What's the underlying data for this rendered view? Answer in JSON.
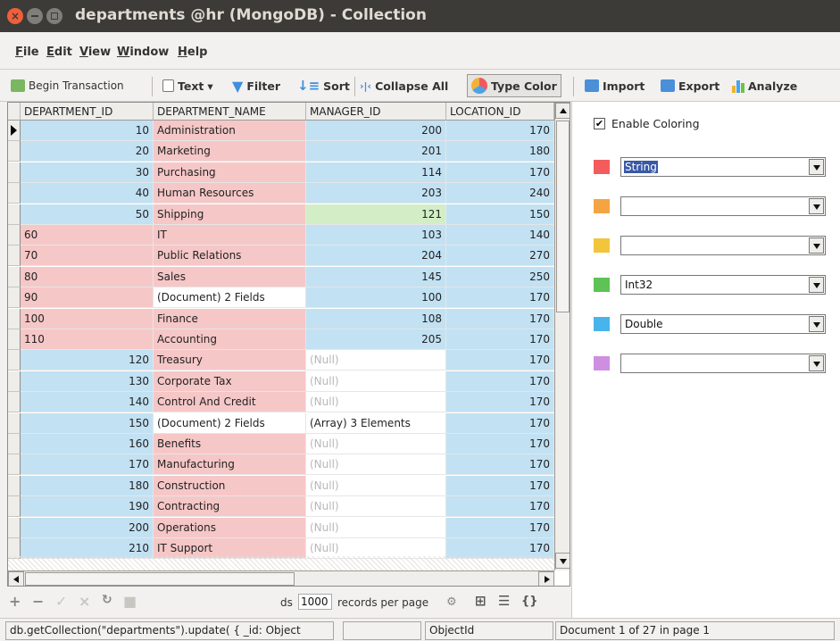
{
  "window": {
    "title": "departments @hr (MongoDB) - Collection"
  },
  "menu": [
    {
      "label": "File",
      "key": "F",
      "rest": "ile"
    },
    {
      "label": "Edit",
      "key": "E",
      "rest": "dit"
    },
    {
      "label": "View",
      "key": "V",
      "rest": "iew"
    },
    {
      "label": "Window",
      "key": "W",
      "rest": "indow"
    },
    {
      "label": "Help",
      "key": "H",
      "rest": "elp"
    }
  ],
  "toolbar": {
    "begin_transaction": "Begin Transaction",
    "text": "Text",
    "filter": "Filter",
    "sort": "Sort",
    "collapse_all": "Collapse All",
    "type_color": "Type Color",
    "import": "Import",
    "export": "Export",
    "analyze": "Analyze"
  },
  "grid": {
    "columns": [
      "DEPARTMENT_ID",
      "DEPARTMENT_NAME",
      "MANAGER_ID",
      "LOCATION_ID"
    ],
    "rows": [
      {
        "id": "10",
        "name": "Administration",
        "manager": "200",
        "location": "170",
        "id_color": "blue",
        "name_color": "red",
        "manager_color": "blue",
        "id_align": "right",
        "name_align": "left"
      },
      {
        "id": "20",
        "name": "Marketing",
        "manager": "201",
        "location": "180",
        "id_color": "blue",
        "name_color": "red",
        "manager_color": "blue",
        "id_align": "right",
        "name_align": "left"
      },
      {
        "id": "30",
        "name": "Purchasing",
        "manager": "114",
        "location": "170",
        "id_color": "blue",
        "name_color": "red",
        "manager_color": "blue",
        "id_align": "right",
        "name_align": "left"
      },
      {
        "id": "40",
        "name": "Human Resources",
        "manager": "203",
        "location": "240",
        "id_color": "blue",
        "name_color": "red",
        "manager_color": "blue",
        "id_align": "right",
        "name_align": "left"
      },
      {
        "id": "50",
        "name": "Shipping",
        "manager": "121",
        "location": "150",
        "id_color": "blue",
        "name_color": "red",
        "manager_color": "green",
        "id_align": "right",
        "name_align": "left"
      },
      {
        "id": "60",
        "name": "IT",
        "manager": "103",
        "location": "140",
        "id_color": "red",
        "name_color": "red",
        "manager_color": "blue",
        "id_align": "left",
        "name_align": "left"
      },
      {
        "id": "70",
        "name": "Public Relations",
        "manager": "204",
        "location": "270",
        "id_color": "red",
        "name_color": "red",
        "manager_color": "blue",
        "id_align": "left",
        "name_align": "left"
      },
      {
        "id": "80",
        "name": "Sales",
        "manager": "145",
        "location": "250",
        "id_color": "red",
        "name_color": "red",
        "manager_color": "blue",
        "id_align": "left",
        "name_align": "left"
      },
      {
        "id": "90",
        "name": "(Document) 2 Fields",
        "manager": "100",
        "location": "170",
        "id_color": "red",
        "name_color": "white",
        "manager_color": "blue",
        "id_align": "left",
        "name_align": "left"
      },
      {
        "id": "100",
        "name": "Finance",
        "manager": "108",
        "location": "170",
        "id_color": "red",
        "name_color": "red",
        "manager_color": "blue",
        "id_align": "left",
        "name_align": "left"
      },
      {
        "id": "110",
        "name": "Accounting",
        "manager": "205",
        "location": "170",
        "id_color": "red",
        "name_color": "red",
        "manager_color": "blue",
        "id_align": "left",
        "name_align": "left"
      },
      {
        "id": "120",
        "name": "Treasury",
        "manager": "(Null)",
        "location": "170",
        "id_color": "blue",
        "name_color": "red",
        "manager_color": "white",
        "id_align": "right",
        "name_align": "left"
      },
      {
        "id": "130",
        "name": "Corporate Tax",
        "manager": "(Null)",
        "location": "170",
        "id_color": "blue",
        "name_color": "red",
        "manager_color": "white",
        "id_align": "right",
        "name_align": "left"
      },
      {
        "id": "140",
        "name": "Control And Credit",
        "manager": "(Null)",
        "location": "170",
        "id_color": "blue",
        "name_color": "red",
        "manager_color": "white",
        "id_align": "right",
        "name_align": "left"
      },
      {
        "id": "150",
        "name": "(Document) 2 Fields",
        "manager": "(Array) 3 Elements",
        "location": "170",
        "id_color": "blue",
        "name_color": "white",
        "manager_color": "white",
        "id_align": "right",
        "name_align": "left"
      },
      {
        "id": "160",
        "name": "Benefits",
        "manager": "(Null)",
        "location": "170",
        "id_color": "blue",
        "name_color": "red",
        "manager_color": "white",
        "id_align": "right",
        "name_align": "left"
      },
      {
        "id": "170",
        "name": "Manufacturing",
        "manager": "(Null)",
        "location": "170",
        "id_color": "blue",
        "name_color": "red",
        "manager_color": "white",
        "id_align": "right",
        "name_align": "left"
      },
      {
        "id": "180",
        "name": "Construction",
        "manager": "(Null)",
        "location": "170",
        "id_color": "blue",
        "name_color": "red",
        "manager_color": "white",
        "id_align": "right",
        "name_align": "left"
      },
      {
        "id": "190",
        "name": "Contracting",
        "manager": "(Null)",
        "location": "170",
        "id_color": "blue",
        "name_color": "red",
        "manager_color": "white",
        "id_align": "right",
        "name_align": "left"
      },
      {
        "id": "200",
        "name": "Operations",
        "manager": "(Null)",
        "location": "170",
        "id_color": "blue",
        "name_color": "red",
        "manager_color": "white",
        "id_align": "right",
        "name_align": "left"
      },
      {
        "id": "210",
        "name": "IT Support",
        "manager": "(Null)",
        "location": "170",
        "id_color": "blue",
        "name_color": "red",
        "manager_color": "white",
        "id_align": "right",
        "name_align": "left"
      }
    ]
  },
  "pager": {
    "records_prefix": "ds",
    "records_per_page_value": "1000",
    "records_per_page_label": "records per page"
  },
  "coloring": {
    "enable_label": "Enable Coloring",
    "enabled": true,
    "rules": [
      {
        "color": "#f25c5c",
        "type": "String",
        "selected": true
      },
      {
        "color": "#f4a443",
        "type": "",
        "selected": false
      },
      {
        "color": "#f2c53d",
        "type": "",
        "selected": false
      },
      {
        "color": "#5ec256",
        "type": "Int32",
        "selected": false
      },
      {
        "color": "#49b4ec",
        "type": "Double",
        "selected": false
      },
      {
        "color": "#cf8fe0",
        "type": "",
        "selected": false
      }
    ]
  },
  "status": {
    "query": "db.getCollection(\"departments\").update( { _id: Object",
    "field2": "",
    "type": "ObjectId",
    "position": "Document 1 of 27 in page 1"
  }
}
